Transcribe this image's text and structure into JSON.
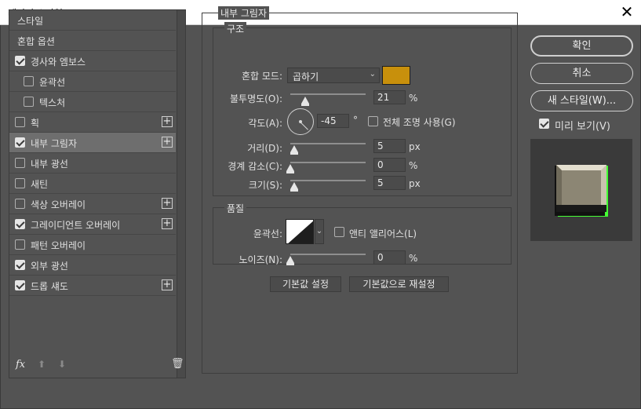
{
  "window": {
    "title": "레이어 스타일",
    "close_glyph": "✕"
  },
  "left_panel": {
    "items": [
      {
        "label": "스타일",
        "has_checkbox": false,
        "checked": false,
        "selected": false,
        "indent": false,
        "has_plus": false
      },
      {
        "label": "혼합 옵션",
        "has_checkbox": false,
        "checked": false,
        "selected": false,
        "indent": false,
        "has_plus": false
      },
      {
        "label": "경사와 엠보스",
        "has_checkbox": true,
        "checked": true,
        "selected": false,
        "indent": false,
        "has_plus": false
      },
      {
        "label": "윤곽선",
        "has_checkbox": true,
        "checked": false,
        "selected": false,
        "indent": true,
        "has_plus": false
      },
      {
        "label": "텍스처",
        "has_checkbox": true,
        "checked": false,
        "selected": false,
        "indent": true,
        "has_plus": false
      },
      {
        "label": "획",
        "has_checkbox": true,
        "checked": false,
        "selected": false,
        "indent": false,
        "has_plus": true
      },
      {
        "label": "내부 그림자",
        "has_checkbox": true,
        "checked": true,
        "selected": true,
        "indent": false,
        "has_plus": true
      },
      {
        "label": "내부 광선",
        "has_checkbox": true,
        "checked": false,
        "selected": false,
        "indent": false,
        "has_plus": false
      },
      {
        "label": "새틴",
        "has_checkbox": true,
        "checked": false,
        "selected": false,
        "indent": false,
        "has_plus": false
      },
      {
        "label": "색상 오버레이",
        "has_checkbox": true,
        "checked": false,
        "selected": false,
        "indent": false,
        "has_plus": true
      },
      {
        "label": "그레이디언트 오버레이",
        "has_checkbox": true,
        "checked": true,
        "selected": false,
        "indent": false,
        "has_plus": true
      },
      {
        "label": "패턴 오버레이",
        "has_checkbox": true,
        "checked": false,
        "selected": false,
        "indent": false,
        "has_plus": false
      },
      {
        "label": "외부 광선",
        "has_checkbox": true,
        "checked": true,
        "selected": false,
        "indent": false,
        "has_plus": false
      },
      {
        "label": "드롭 섀도",
        "has_checkbox": true,
        "checked": true,
        "selected": false,
        "indent": false,
        "has_plus": true
      }
    ],
    "footer": {
      "fx": "fx",
      "up": "⬆",
      "down": "⬇",
      "trash": "🗑"
    }
  },
  "inner_shadow": {
    "title": "내부 그림자",
    "structure": {
      "title": "구조",
      "blend_mode_label": "혼합 모드:",
      "blend_mode_value": "곱하기",
      "shadow_color": "#c8900c",
      "opacity_label": "불투명도(O):",
      "opacity_value": "21",
      "opacity_unit": "%",
      "angle_label": "각도(A):",
      "angle_value": "-45",
      "angle_unit": "°",
      "global_light_label": "전체 조명 사용(G)",
      "global_light_checked": false,
      "distance_label": "거리(D):",
      "distance_value": "5",
      "distance_unit": "px",
      "choke_label": "경계 감소(C):",
      "choke_value": "0",
      "choke_unit": "%",
      "size_label": "크기(S):",
      "size_value": "5",
      "size_unit": "px"
    },
    "quality": {
      "title": "품질",
      "contour_label": "윤곽선:",
      "anti_alias_label": "앤티 앨리어스(L)",
      "anti_alias_checked": false,
      "noise_label": "노이즈(N):",
      "noise_value": "0",
      "noise_unit": "%"
    },
    "make_default_label": "기본값 설정",
    "reset_default_label": "기본값으로 재설정"
  },
  "buttons": {
    "ok": "확인",
    "cancel": "취소",
    "new_style": "새 스타일(W)...",
    "preview_label": "미리 보기(V)",
    "preview_checked": true
  }
}
